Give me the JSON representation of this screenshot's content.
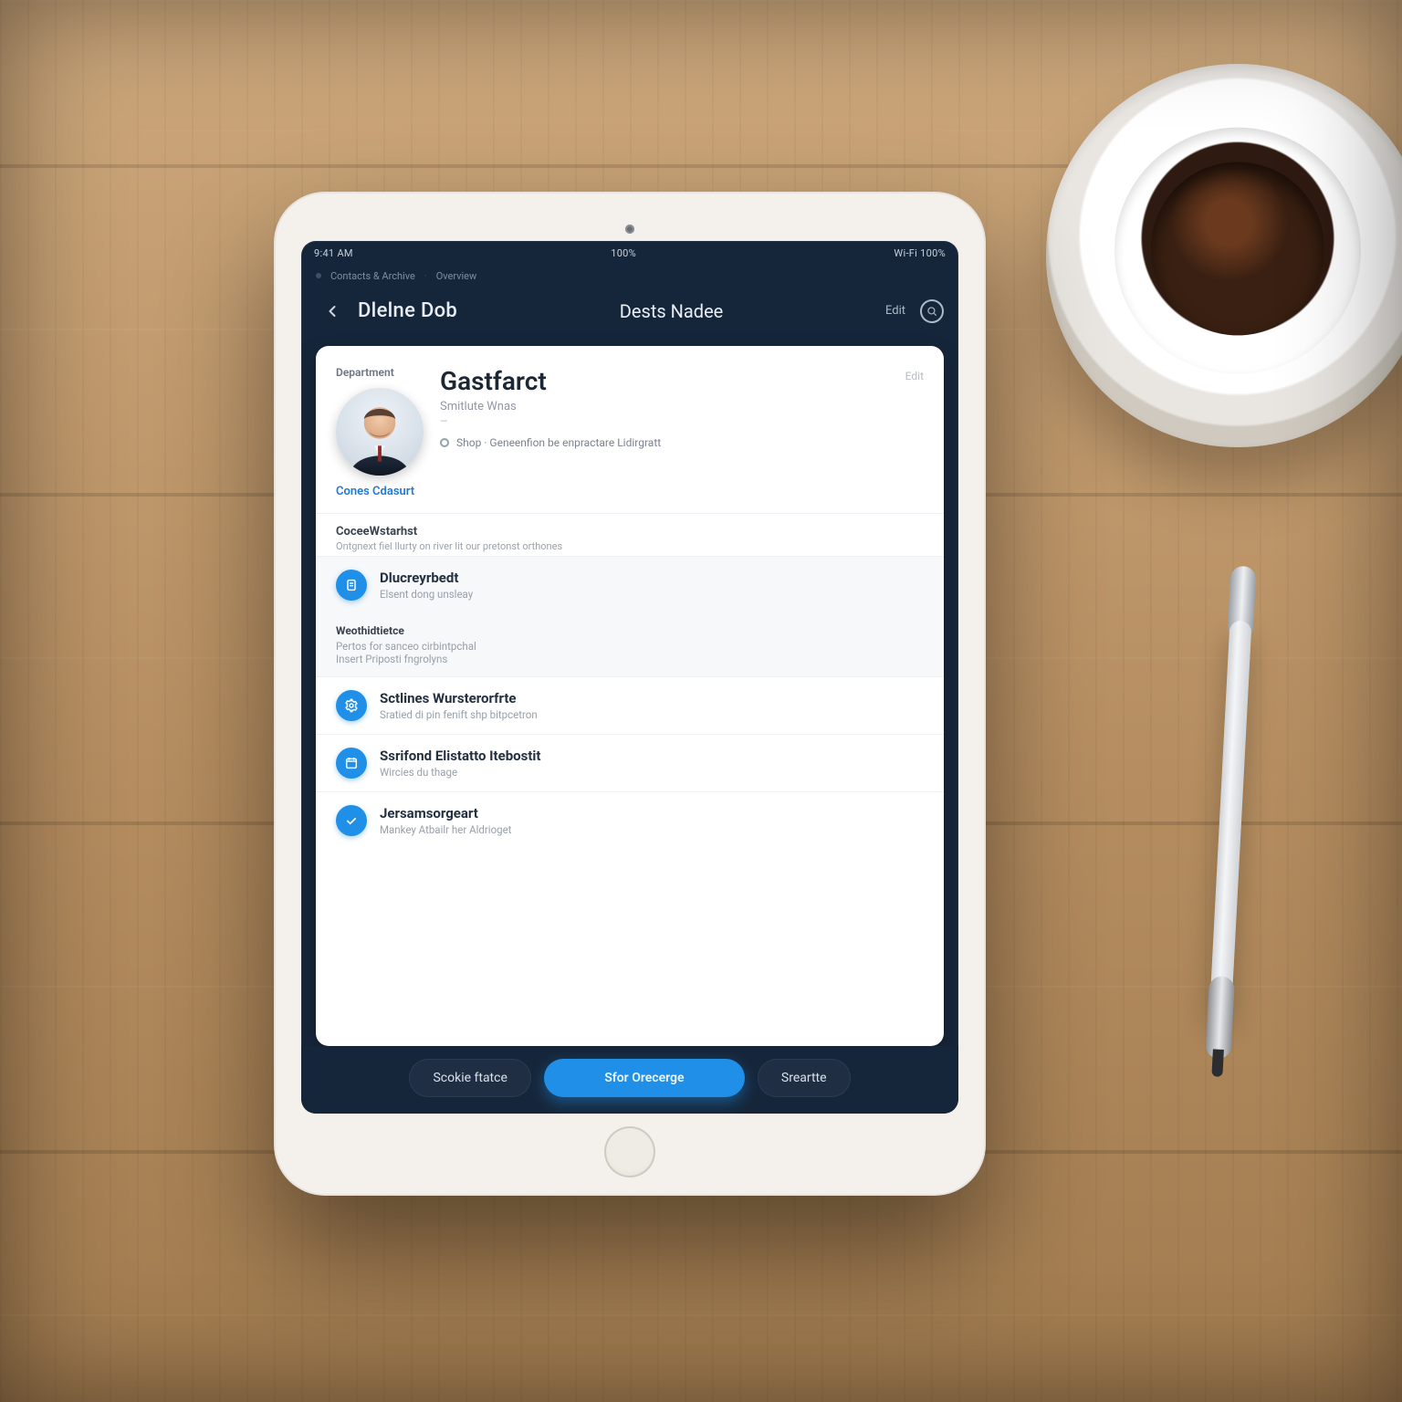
{
  "status": {
    "left": "9:41 AM",
    "center": "100%",
    "right": "Wi‑Fi  100%"
  },
  "crumbs": {
    "a": "Contacts & Archive",
    "b": "Overview"
  },
  "header": {
    "left_title": "Dlelne Dob",
    "center_title": "Dests Nadee",
    "right_link": "Edit",
    "search_icon": "search"
  },
  "card": {
    "eyebrow": "Department",
    "name": "Gastfarct",
    "subtitle": "Smitlute Wnas",
    "meta": "—",
    "location": "Shop · Geneenfion be enpractare Lidirgratt",
    "link": "Cones Cdasurt",
    "right_badge": "Edit"
  },
  "section1": {
    "label": "CoceeWstarhst",
    "hint": "Ontgnext fiel llurty on river lit our pretonst orthones"
  },
  "row1": {
    "title": "Dlucreyrbedt",
    "sub": "Elsent dong unsleay"
  },
  "block": {
    "title": "Weothidtietce",
    "line1": "Pertos for sanceo cirbintpchal",
    "line2": "Insert Priposti fngrolyns"
  },
  "row2": {
    "title": "Sctlines Wursterorfrte",
    "sub": "Sratied di pin fenift shp bitpcetron"
  },
  "row3": {
    "title": "Ssrifond Elistatto Itebostit",
    "sub": "Wircies du thage"
  },
  "row4": {
    "title": "Jersamsorgeart",
    "sub": "Mankey Atbailr her Aldrioget"
  },
  "footer": {
    "left": "Scokie ftatce",
    "primary": "Sfor Orecerge",
    "right": "Sreartte"
  },
  "colors": {
    "brand": "#1f8fe7",
    "navy": "#16263a"
  }
}
